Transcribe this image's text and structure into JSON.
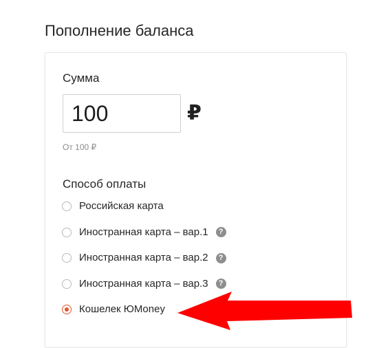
{
  "page": {
    "title": "Пополнение баланса"
  },
  "amount": {
    "label": "Сумма",
    "value": "100",
    "currency_symbol": "₽",
    "hint": "От 100 ₽"
  },
  "payment": {
    "label": "Способ оплаты",
    "options": [
      {
        "label": "Российская карта",
        "selected": false,
        "help": false
      },
      {
        "label": "Иностранная карта – вар.1",
        "selected": false,
        "help": true
      },
      {
        "label": "Иностранная карта – вар.2",
        "selected": false,
        "help": true
      },
      {
        "label": "Иностранная карта – вар.3",
        "selected": false,
        "help": true
      },
      {
        "label": "Кошелек ЮMoney",
        "selected": true,
        "help": false
      }
    ],
    "help_glyph": "?"
  },
  "colors": {
    "accent": "#e2562a",
    "arrow": "#ff0000"
  }
}
